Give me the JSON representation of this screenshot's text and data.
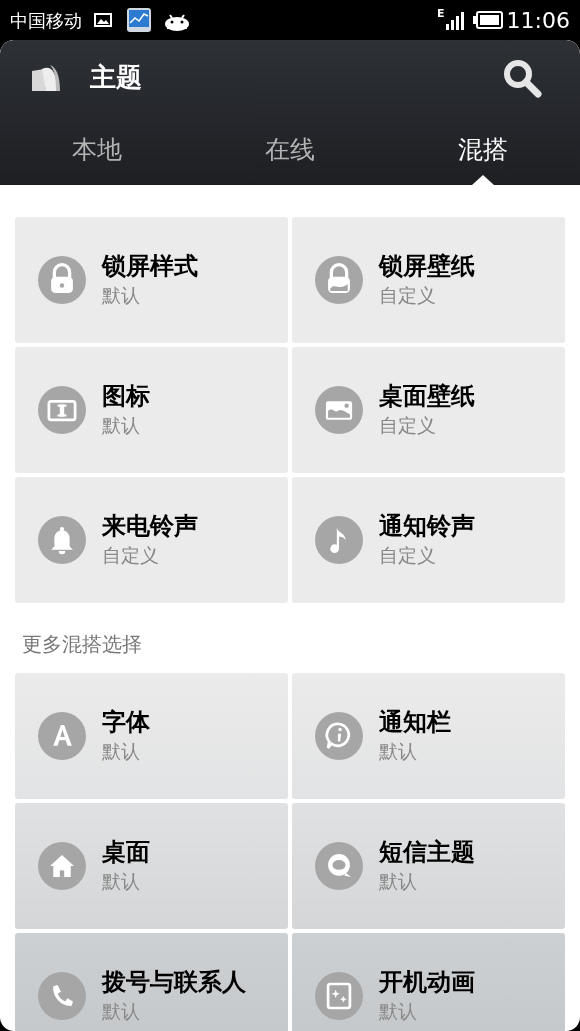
{
  "status_bar": {
    "carrier": "中国移动",
    "network": "E",
    "time": "11:06"
  },
  "header": {
    "title": "主题"
  },
  "tabs": [
    {
      "label": "本地",
      "selected": false
    },
    {
      "label": "在线",
      "selected": false
    },
    {
      "label": "混搭",
      "selected": true
    }
  ],
  "sections": [
    {
      "tiles": [
        {
          "title": "锁屏样式",
          "value": "默认",
          "kind": "lock"
        },
        {
          "title": "锁屏壁纸",
          "value": "自定义",
          "kind": "lockpic"
        },
        {
          "title": "图标",
          "value": "默认",
          "kind": "frame"
        },
        {
          "title": "桌面壁纸",
          "value": "自定义",
          "kind": "image"
        },
        {
          "title": "来电铃声",
          "value": "自定义",
          "kind": "bell"
        },
        {
          "title": "通知铃声",
          "value": "自定义",
          "kind": "note"
        }
      ]
    },
    {
      "heading": "更多混搭选择",
      "tiles": [
        {
          "title": "字体",
          "value": "默认",
          "kind": "font"
        },
        {
          "title": "通知栏",
          "value": "默认",
          "kind": "info"
        },
        {
          "title": "桌面",
          "value": "默认",
          "kind": "home"
        },
        {
          "title": "短信主题",
          "value": "默认",
          "kind": "chat"
        },
        {
          "title": "拨号与联系人",
          "value": "默认",
          "kind": "phone"
        },
        {
          "title": "开机动画",
          "value": "默认",
          "kind": "sparkle"
        }
      ]
    }
  ]
}
